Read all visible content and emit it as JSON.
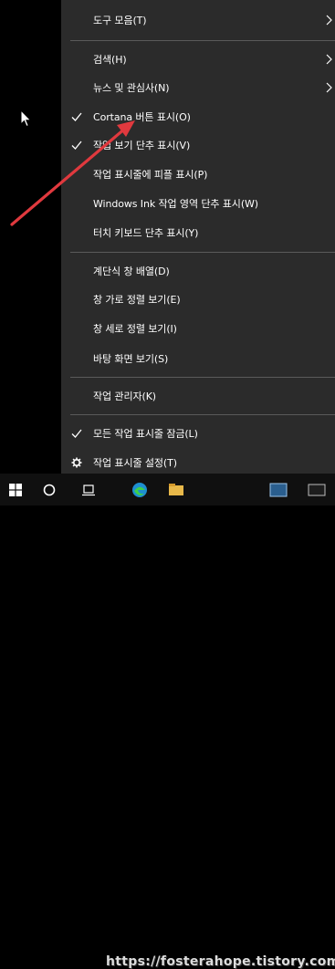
{
  "menu": {
    "items": [
      {
        "label": "도구 모음(T)",
        "submenu": true,
        "checked": false
      },
      {
        "label": "검색(H)",
        "submenu": true,
        "checked": false
      },
      {
        "label": "뉴스 및 관심사(N)",
        "submenu": true,
        "checked": false
      },
      {
        "label": "Cortana 버튼 표시(O)",
        "submenu": false,
        "checked": true
      },
      {
        "label": "작업 보기 단추 표시(V)",
        "submenu": false,
        "checked": true
      },
      {
        "label": "작업 표시줄에 피플 표시(P)",
        "submenu": false,
        "checked": false
      },
      {
        "label": "Windows Ink 작업 영역 단추 표시(W)",
        "submenu": false,
        "checked": false
      },
      {
        "label": "터치 키보드 단추 표시(Y)",
        "submenu": false,
        "checked": false
      },
      {
        "label": "계단식 창 배열(D)",
        "submenu": false,
        "checked": false
      },
      {
        "label": "창 가로 정렬 보기(E)",
        "submenu": false,
        "checked": false
      },
      {
        "label": "창 세로 정렬 보기(I)",
        "submenu": false,
        "checked": false
      },
      {
        "label": "바탕 화면 보기(S)",
        "submenu": false,
        "checked": false
      },
      {
        "label": "작업 관리자(K)",
        "submenu": false,
        "checked": false
      },
      {
        "label": "모든 작업 표시줄 잠금(L)",
        "submenu": false,
        "checked": true
      },
      {
        "label": "작업 표시줄 설정(T)",
        "submenu": false,
        "checked": false,
        "icon": "gear-icon"
      }
    ]
  },
  "watermark": "https://fosterahope.tistory.com",
  "colors": {
    "menu_bg": "#2b2b2b",
    "separator": "#5a5a5a",
    "annotation_arrow": "#e0393e",
    "taskbar_bg": "#101010"
  },
  "taskbar": {
    "icons": [
      "windows-start-icon",
      "search-circle-icon",
      "task-view-icon",
      "edge-icon",
      "app-icon",
      "app-icon",
      "tray-icon"
    ]
  }
}
